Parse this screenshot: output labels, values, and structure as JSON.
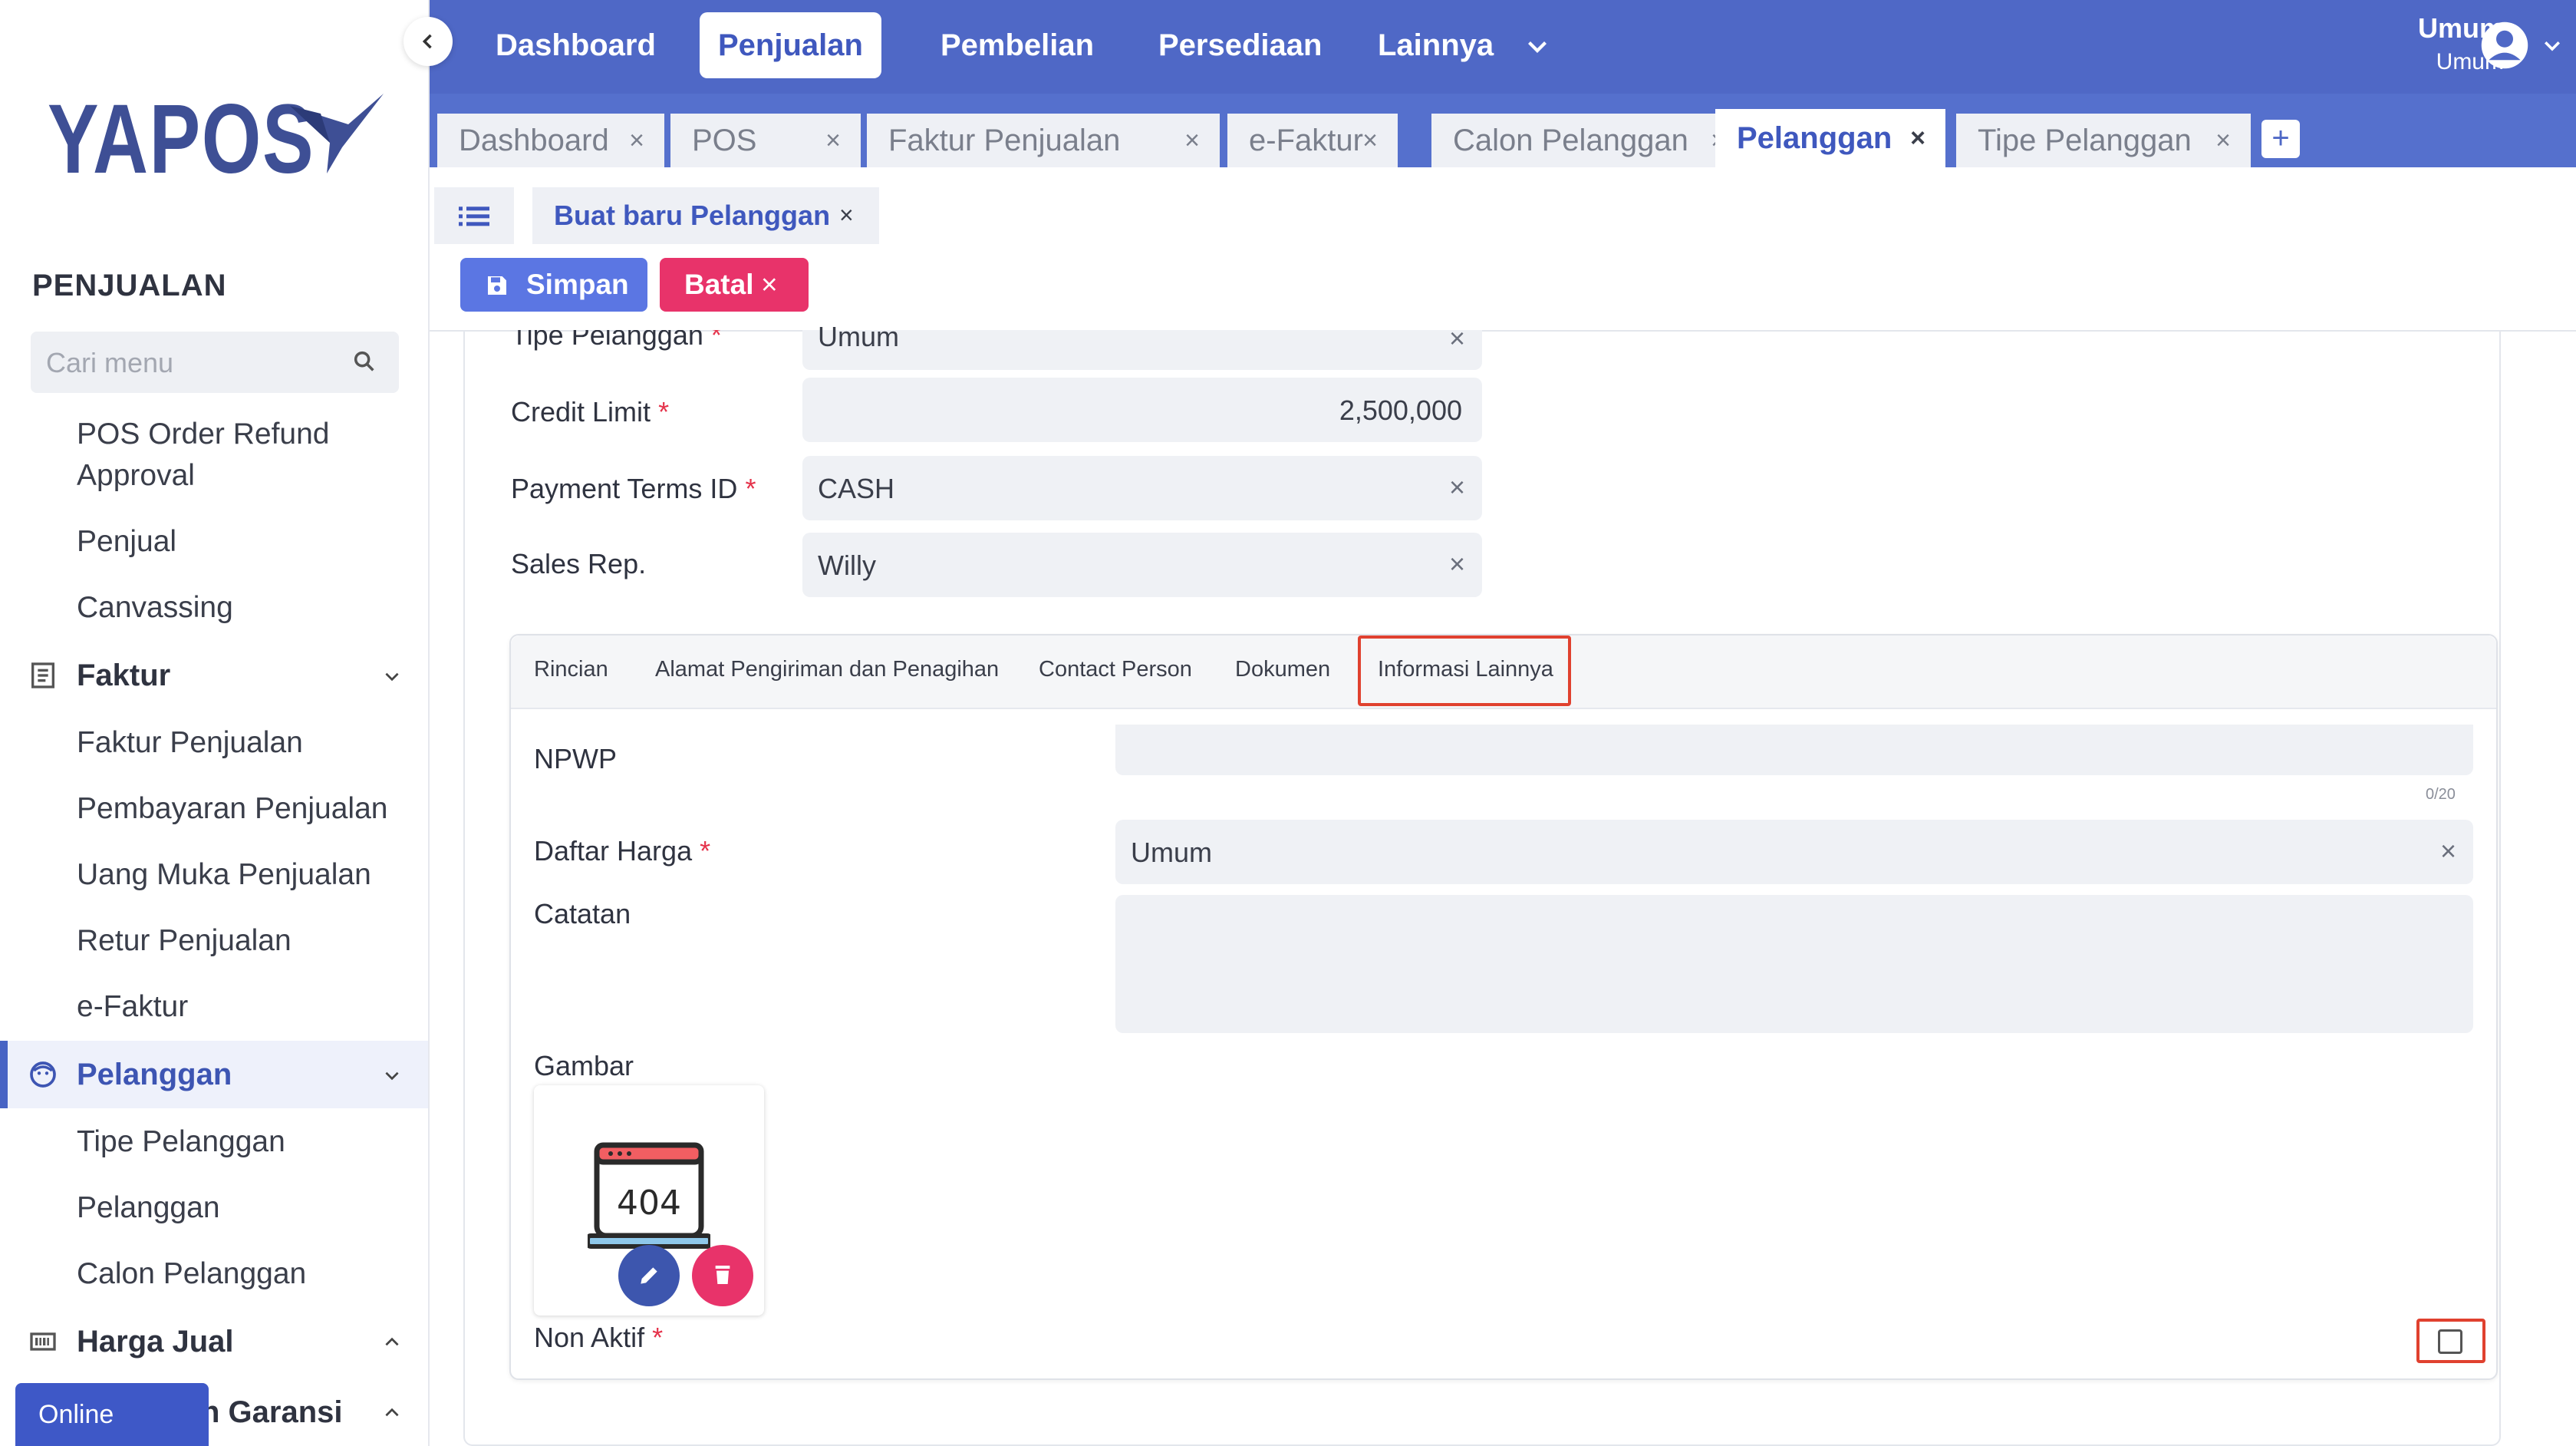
{
  "app": {
    "brand": "YAPOS"
  },
  "sidebar": {
    "section_title": "PENJUALAN",
    "search_placeholder": "Cari menu",
    "items_top": [
      "POS Order Refund",
      "Approval",
      "Penjual",
      "Canvassing"
    ],
    "groups": {
      "faktur": {
        "label": "Faktur",
        "items": [
          "Faktur Penjualan",
          "Pembayaran Penjualan",
          "Uang Muka Penjualan",
          "Retur Penjualan",
          "e-Faktur"
        ]
      },
      "pelanggan": {
        "label": "Pelanggan",
        "items": [
          "Tipe Pelanggan",
          "Pelanggan",
          "Calon Pelanggan"
        ]
      },
      "harga_jual": {
        "label": "Harga Jual"
      },
      "garansi": {
        "label": "n Garansi"
      }
    },
    "status": "Online"
  },
  "topnav": {
    "items": [
      "Dashboard",
      "Penjualan",
      "Pembelian",
      "Persediaan",
      "Lainnya"
    ],
    "user_name": "Umum",
    "user_role": "Umum"
  },
  "tabs": [
    "Dashboard",
    "POS",
    "Faktur Penjualan",
    "e-Faktur",
    "Calon Pelanggan",
    "Pelanggan",
    "Tipe Pelanggan"
  ],
  "subtab": {
    "label": "Buat baru Pelanggan"
  },
  "toolbar": {
    "save_label": "Simpan",
    "cancel_label": "Batal"
  },
  "form": {
    "tipe_pelanggan": {
      "label": "Tipe Pelanggan",
      "value": "Umum"
    },
    "credit_limit": {
      "label": "Credit Limit",
      "value": "2,500,000"
    },
    "payment_terms": {
      "label": "Payment Terms ID",
      "value": "CASH"
    },
    "sales_rep": {
      "label": "Sales Rep.",
      "value": "Willy"
    },
    "required_mark": "*"
  },
  "inner_tabs": [
    "Rincian",
    "Alamat Pengiriman dan Penagihan",
    "Contact Person",
    "Dokumen",
    "Informasi Lainnya"
  ],
  "info": {
    "npwp_label": "NPWP",
    "npwp_counter": "0/20",
    "daftar_harga_label": "Daftar Harga",
    "daftar_harga_value": "Umum",
    "catatan_label": "Catatan",
    "gambar_label": "Gambar",
    "image_text": "404",
    "non_aktif_label": "Non Aktif"
  },
  "colors": {
    "primary": "#4f68c6",
    "danger": "#e8336a",
    "highlight": "#e0412f"
  }
}
